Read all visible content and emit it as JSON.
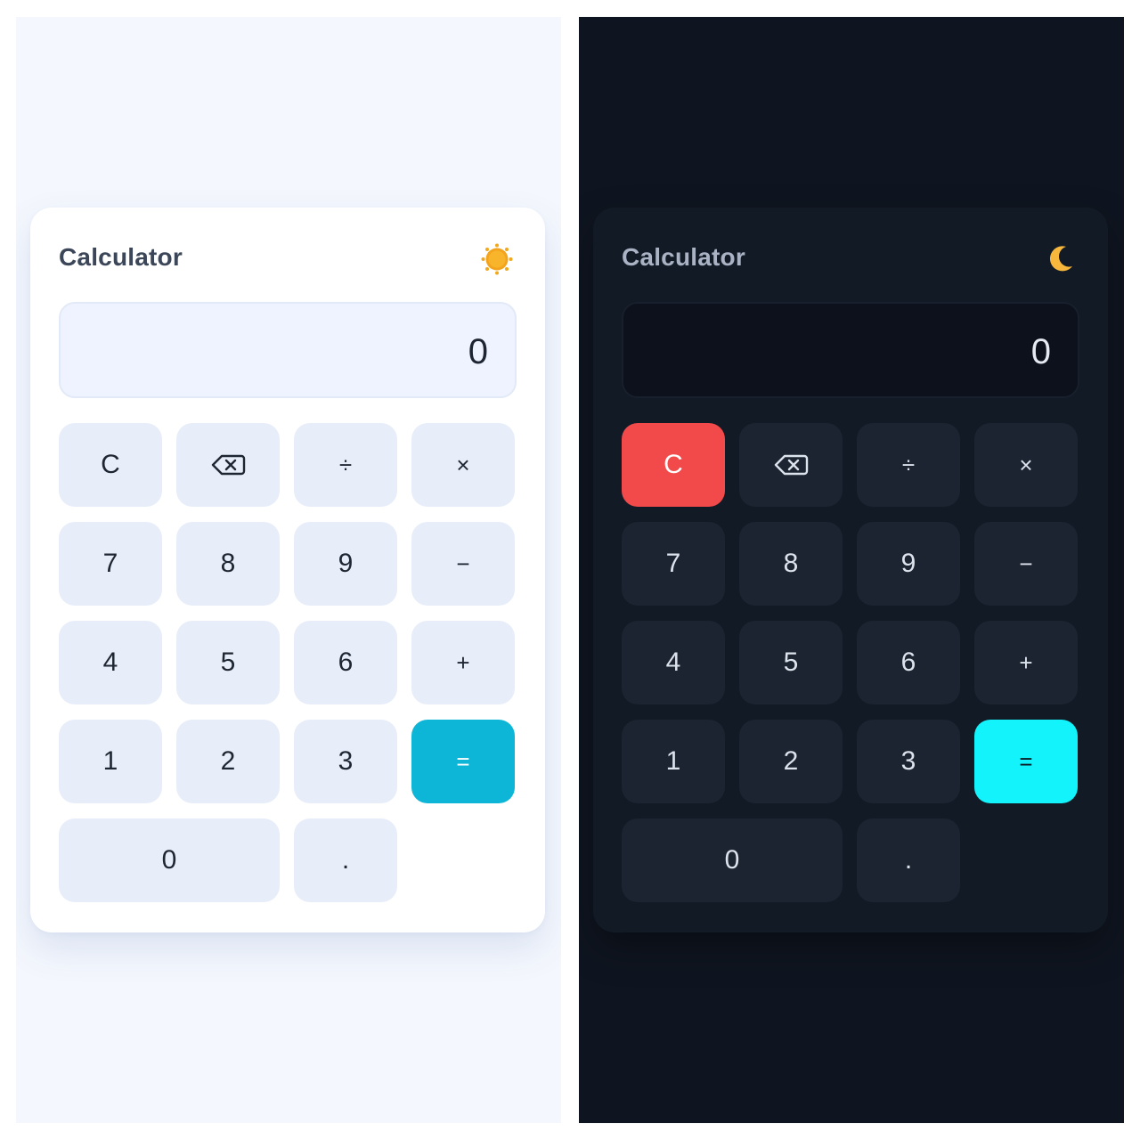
{
  "colors": {
    "light_background": "#f4f7fd",
    "light_card": "#ffffff",
    "light_key": "#e7eef9",
    "light_equals": "#0db6d6",
    "dark_background": "#0f1520",
    "dark_card": "#121a26",
    "dark_key": "#1c2432",
    "dark_equals": "#13f3fb",
    "dark_clear": "#f24a4a"
  },
  "light": {
    "title": "Calculator",
    "theme_icon": "sun-icon",
    "display": "0",
    "keys": {
      "clear": "C",
      "backspace_icon": "backspace-icon",
      "divide": "÷",
      "multiply": "×",
      "seven": "7",
      "eight": "8",
      "nine": "9",
      "minus": "−",
      "four": "4",
      "five": "5",
      "six": "6",
      "plus": "+",
      "one": "1",
      "two": "2",
      "three": "3",
      "equals": "=",
      "zero": "0",
      "decimal": "."
    }
  },
  "dark": {
    "title": "Calculator",
    "theme_icon": "moon-icon",
    "display": "0",
    "keys": {
      "clear": "C",
      "backspace_icon": "backspace-icon",
      "divide": "÷",
      "multiply": "×",
      "seven": "7",
      "eight": "8",
      "nine": "9",
      "minus": "−",
      "four": "4",
      "five": "5",
      "six": "6",
      "plus": "+",
      "one": "1",
      "two": "2",
      "three": "3",
      "equals": "=",
      "zero": "0",
      "decimal": "."
    }
  }
}
